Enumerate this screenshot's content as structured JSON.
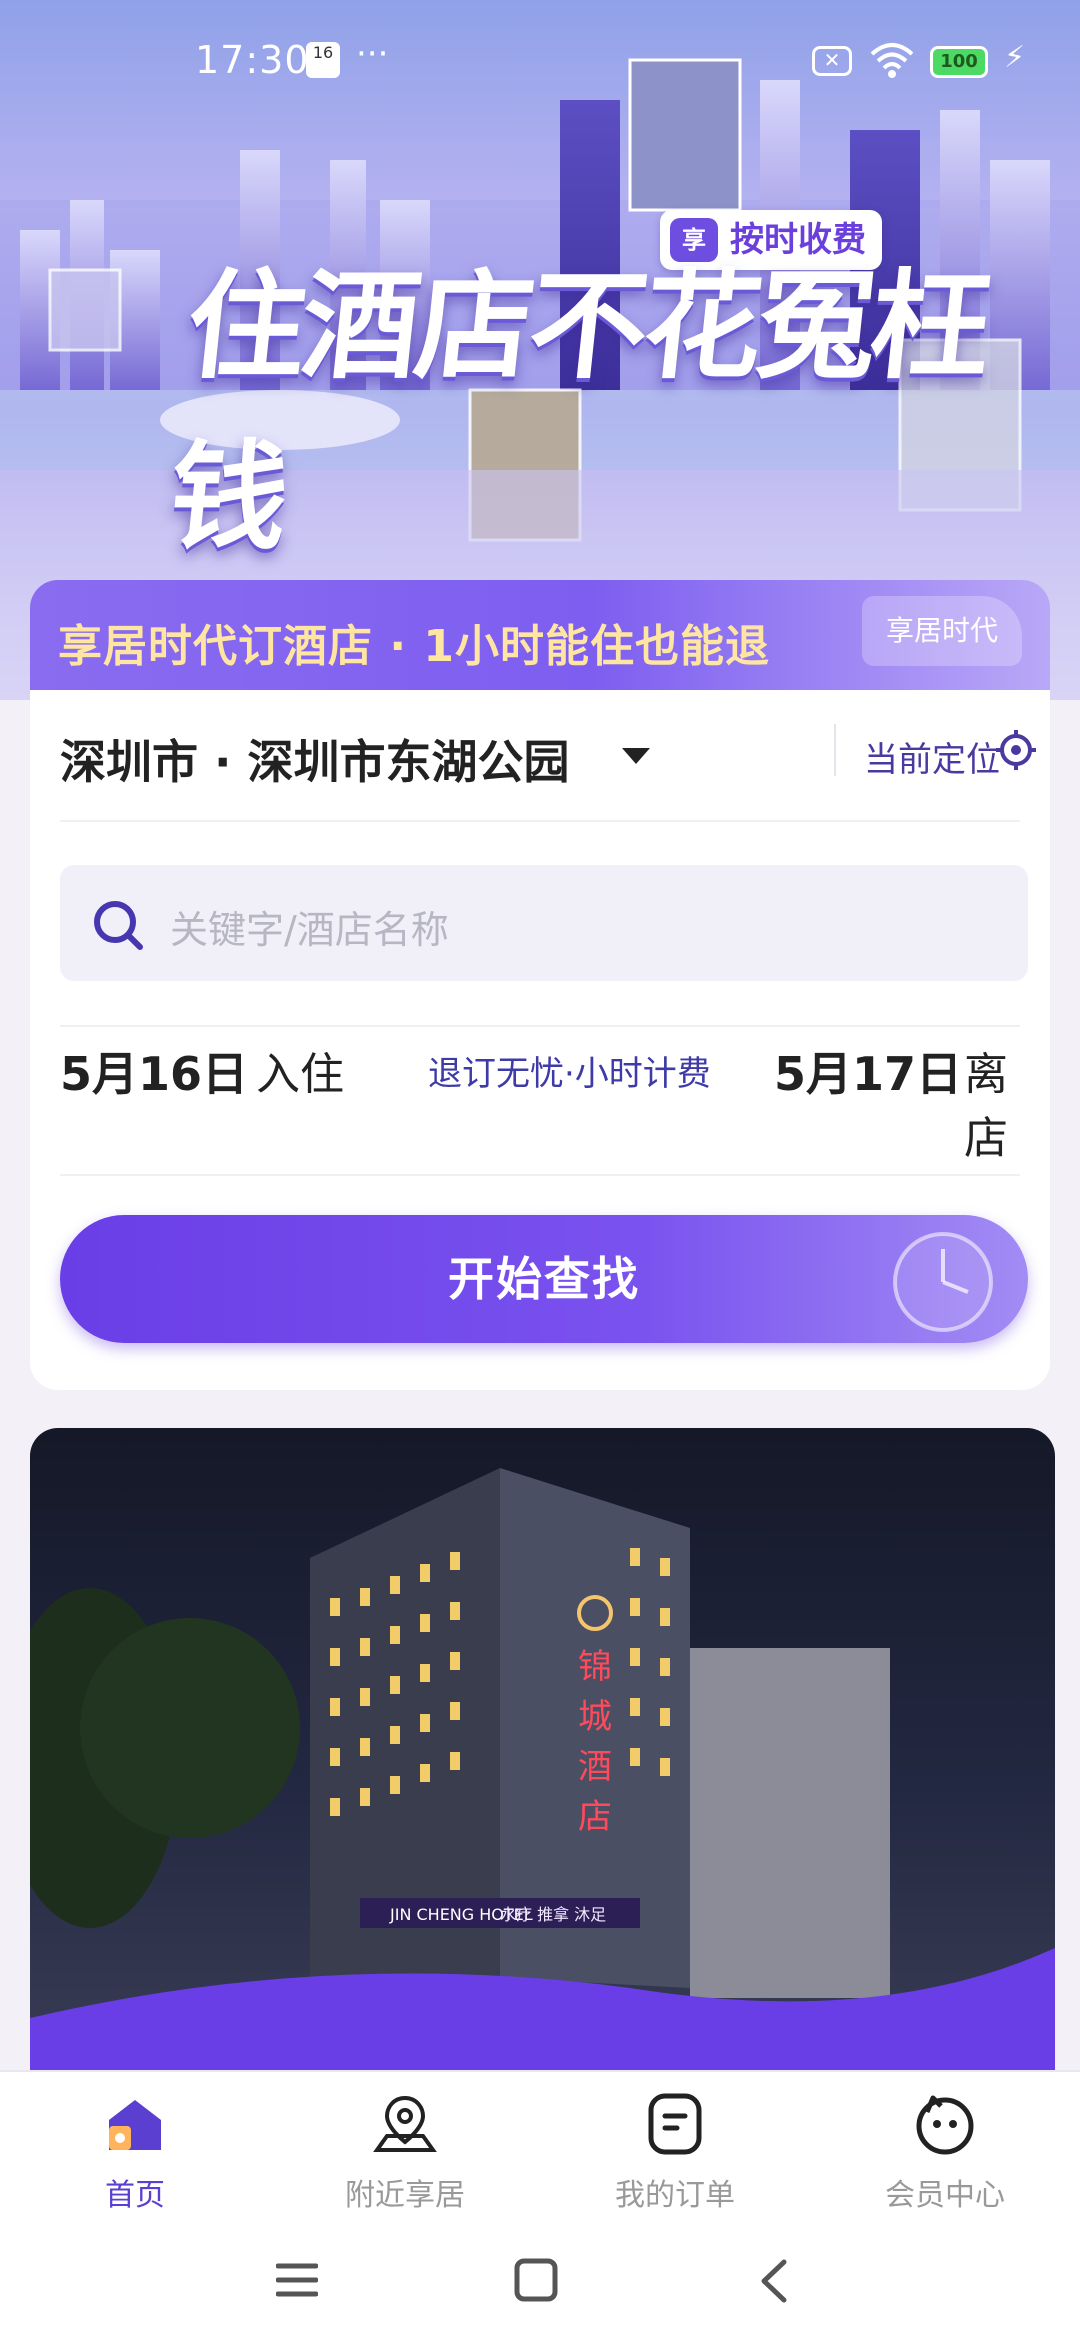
{
  "status_bar": {
    "time": "17:30",
    "calendar_day": "16",
    "more": "···",
    "battery": "100"
  },
  "hero": {
    "slogan": "住酒店不花冤枉钱",
    "tag": "按时收费",
    "tag_logo": "享"
  },
  "promo": {
    "text": "享居时代订酒店 · 1小时能住也能退",
    "logo": "享居时代"
  },
  "search": {
    "location": "深圳市 · 深圳市东湖公园",
    "current_location": "当前定位",
    "placeholder": "关键字/酒店名称",
    "checkin_date": "5月16日",
    "checkin_label": "入住",
    "middle_note": "退订无忧·小时计费",
    "checkout_date": "5月17日",
    "checkout_label": "离店",
    "submit": "开始查找"
  },
  "banner": {
    "sign": "锦城酒店",
    "english_sign": "JIN CHENG HOTEL",
    "sub_sign": "水疗 推拿 沐足"
  },
  "tabs": [
    {
      "label": "首页",
      "icon": "home-icon",
      "active": true
    },
    {
      "label": "附近享居",
      "icon": "map-pin-icon",
      "active": false
    },
    {
      "label": "我的订单",
      "icon": "order-icon",
      "active": false
    },
    {
      "label": "会员中心",
      "icon": "member-icon",
      "active": false
    }
  ],
  "colors": {
    "primary": "#6a3ee6",
    "accent_text": "#ffe5a2",
    "tab_active": "#5a3fd0",
    "tab_inactive": "#999999"
  }
}
